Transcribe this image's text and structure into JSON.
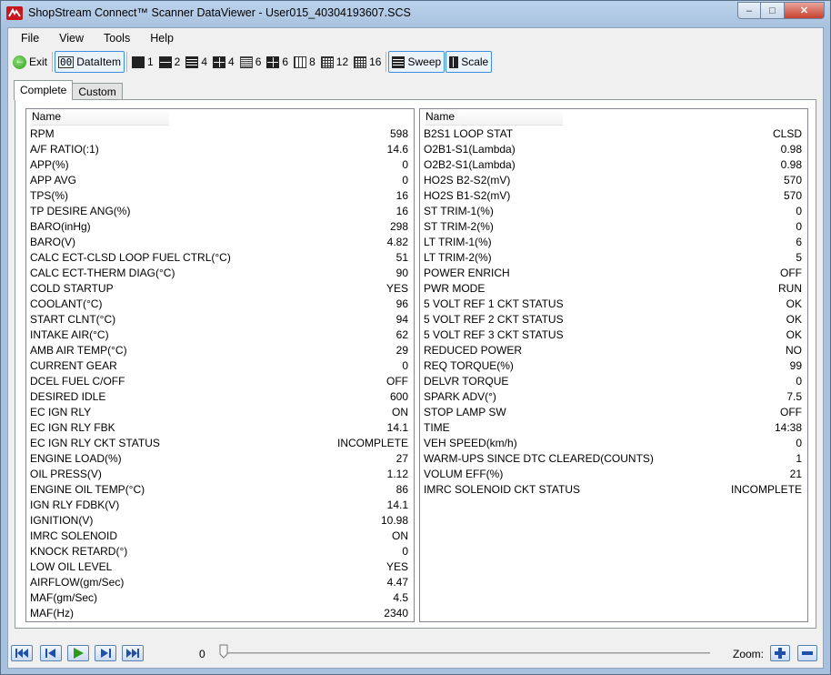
{
  "window": {
    "title": "ShopStream Connect™ Scanner DataViewer - User015_40304193607.SCS",
    "minimize": "–",
    "maximize": "□",
    "close": "✕"
  },
  "menu": [
    "File",
    "View",
    "Tools",
    "Help"
  ],
  "toolbar": {
    "exit": "Exit",
    "dataitem": "DataItem",
    "layouts": [
      "1",
      "2",
      "4",
      "4",
      "6",
      "6",
      "8",
      "12",
      "16"
    ],
    "sweep": "Sweep",
    "scale": "Scale"
  },
  "tabs": [
    "Complete",
    "Custom"
  ],
  "left_pane": {
    "header": "Name",
    "rows": [
      {
        "name": "RPM",
        "value": "598"
      },
      {
        "name": "A/F RATIO(:1)",
        "value": "14.6"
      },
      {
        "name": "APP(%)",
        "value": "0"
      },
      {
        "name": "APP AVG",
        "value": "0"
      },
      {
        "name": "TPS(%)",
        "value": "16"
      },
      {
        "name": "TP DESIRE ANG(%)",
        "value": "16"
      },
      {
        "name": "BARO(inHg)",
        "value": "298"
      },
      {
        "name": "BARO(V)",
        "value": "4.82"
      },
      {
        "name": "CALC ECT-CLSD LOOP FUEL CTRL(°C)",
        "value": "51"
      },
      {
        "name": "CALC ECT-THERM DIAG(°C)",
        "value": "90"
      },
      {
        "name": "COLD STARTUP",
        "value": "YES"
      },
      {
        "name": "COOLANT(°C)",
        "value": "96"
      },
      {
        "name": "START CLNT(°C)",
        "value": "94"
      },
      {
        "name": "INTAKE AIR(°C)",
        "value": "62"
      },
      {
        "name": "AMB AIR TEMP(°C)",
        "value": "29"
      },
      {
        "name": "CURRENT GEAR",
        "value": "0"
      },
      {
        "name": "DCEL FUEL C/OFF",
        "value": "OFF"
      },
      {
        "name": "DESIRED IDLE",
        "value": "600"
      },
      {
        "name": "EC IGN RLY",
        "value": "ON"
      },
      {
        "name": "EC IGN RLY FBK",
        "value": "14.1"
      },
      {
        "name": "EC IGN RLY CKT STATUS",
        "value": "INCOMPLETE"
      },
      {
        "name": "ENGINE LOAD(%)",
        "value": "27"
      },
      {
        "name": "OIL PRESS(V)",
        "value": "1.12"
      },
      {
        "name": "ENGINE OIL TEMP(°C)",
        "value": "86"
      },
      {
        "name": "IGN RLY FDBK(V)",
        "value": "14.1"
      },
      {
        "name": "IGNITION(V)",
        "value": "10.98"
      },
      {
        "name": "IMRC SOLENOID",
        "value": "ON"
      },
      {
        "name": "KNOCK RETARD(°)",
        "value": "0"
      },
      {
        "name": "LOW OIL LEVEL",
        "value": "YES"
      },
      {
        "name": "AIRFLOW(gm/Sec)",
        "value": "4.47"
      },
      {
        "name": "MAF(gm/Sec)",
        "value": "4.5"
      },
      {
        "name": "MAF(Hz)",
        "value": "2340"
      }
    ]
  },
  "right_pane": {
    "header": "Name",
    "rows": [
      {
        "name": "B2S1 LOOP STAT",
        "value": "CLSD"
      },
      {
        "name": "O2B1-S1(Lambda)",
        "value": "0.98"
      },
      {
        "name": "O2B2-S1(Lambda)",
        "value": "0.98"
      },
      {
        "name": "HO2S B2-S2(mV)",
        "value": "570"
      },
      {
        "name": "HO2S B1-S2(mV)",
        "value": "570"
      },
      {
        "name": "ST TRIM-1(%)",
        "value": "0"
      },
      {
        "name": "ST TRIM-2(%)",
        "value": "0"
      },
      {
        "name": "LT TRIM-1(%)",
        "value": "6"
      },
      {
        "name": "LT TRIM-2(%)",
        "value": "5"
      },
      {
        "name": "POWER ENRICH",
        "value": "OFF"
      },
      {
        "name": "PWR MODE",
        "value": "RUN"
      },
      {
        "name": "5 VOLT REF 1 CKT STATUS",
        "value": "OK"
      },
      {
        "name": "5 VOLT REF 2 CKT STATUS",
        "value": "OK"
      },
      {
        "name": "5 VOLT REF 3 CKT STATUS",
        "value": "OK"
      },
      {
        "name": "REDUCED POWER",
        "value": "NO"
      },
      {
        "name": "REQ TORQUE(%)",
        "value": "99"
      },
      {
        "name": "DELVR TORQUE",
        "value": "0"
      },
      {
        "name": "SPARK ADV(°)",
        "value": "7.5"
      },
      {
        "name": "STOP LAMP SW",
        "value": "OFF"
      },
      {
        "name": "TIME",
        "value": "14:38"
      },
      {
        "name": "VEH SPEED(km/h)",
        "value": "0"
      },
      {
        "name": "WARM-UPS SINCE DTC CLEARED(COUNTS)",
        "value": "1"
      },
      {
        "name": "VOLUM EFF(%)",
        "value": "21"
      },
      {
        "name": "IMRC SOLENOID CKT STATUS",
        "value": "INCOMPLETE"
      }
    ]
  },
  "playback": {
    "position": "0",
    "slider_fraction": 0,
    "zoom_label": "Zoom:"
  },
  "colors": {
    "accent": "#3d8ee0",
    "play_green": "#2e9a1c",
    "nav_blue": "#1f4fa8",
    "logo_red": "#c8161d"
  }
}
